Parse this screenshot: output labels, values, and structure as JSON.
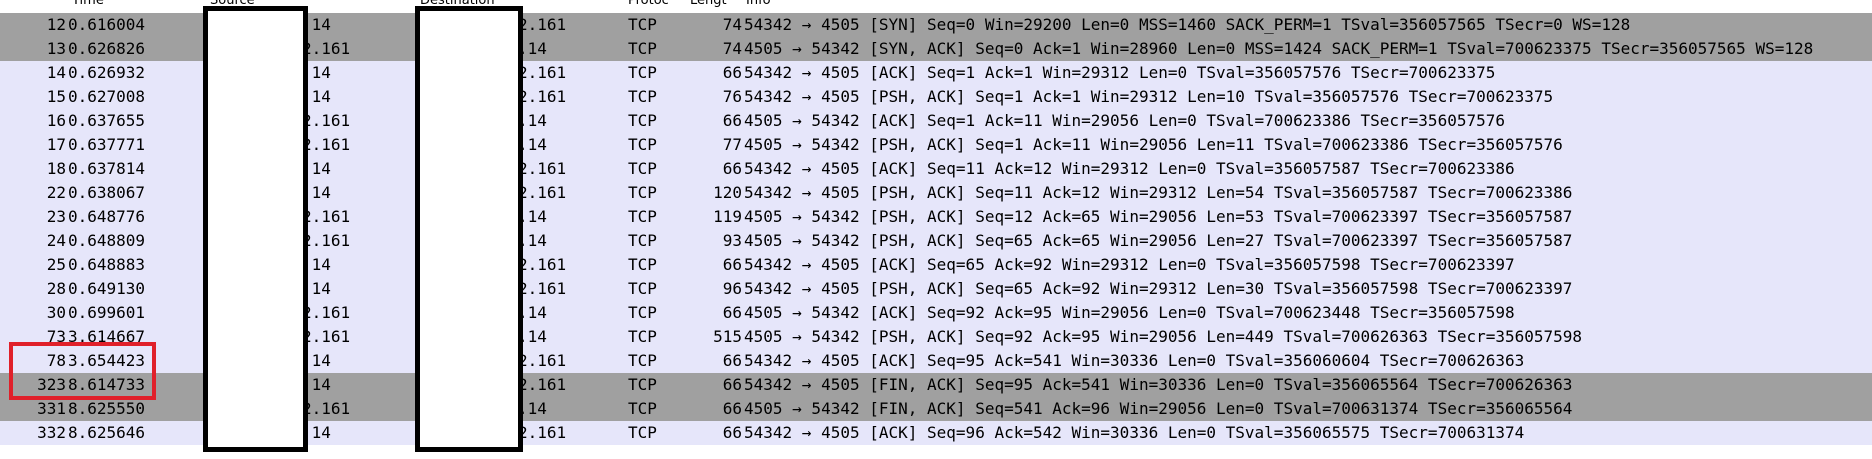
{
  "columns": {
    "time": "Time",
    "source": "Source",
    "destination": "Destination",
    "protocol": "Protoc",
    "length": "Lengt",
    "info": "Info"
  },
  "packets": [
    {
      "no": "12",
      "time": "0.616004",
      "src": ".14",
      "dst": "2.161",
      "proto": "TCP",
      "len": "74",
      "info": "54342 → 4505 [SYN] Seq=0 Win=29200 Len=0 MSS=1460 SACK_PERM=1 TSval=356057565 TSecr=0 WS=128",
      "dark": true
    },
    {
      "no": "13",
      "time": "0.626826",
      "src": "2.161",
      "dst": ".14",
      "proto": "TCP",
      "len": "74",
      "info": "4505 → 54342 [SYN, ACK] Seq=0 Ack=1 Win=28960 Len=0 MSS=1424 SACK_PERM=1 TSval=700623375 TSecr=356057565 WS=128",
      "dark": true
    },
    {
      "no": "14",
      "time": "0.626932",
      "src": ".14",
      "dst": "2.161",
      "proto": "TCP",
      "len": "66",
      "info": "54342 → 4505 [ACK] Seq=1 Ack=1 Win=29312 Len=0 TSval=356057576 TSecr=700623375",
      "dark": false
    },
    {
      "no": "15",
      "time": "0.627008",
      "src": ".14",
      "dst": "2.161",
      "proto": "TCP",
      "len": "76",
      "info": "54342 → 4505 [PSH, ACK] Seq=1 Ack=1 Win=29312 Len=10 TSval=356057576 TSecr=700623375",
      "dark": false
    },
    {
      "no": "16",
      "time": "0.637655",
      "src": "2.161",
      "dst": ".14",
      "proto": "TCP",
      "len": "66",
      "info": "4505 → 54342 [ACK] Seq=1 Ack=11 Win=29056 Len=0 TSval=700623386 TSecr=356057576",
      "dark": false
    },
    {
      "no": "17",
      "time": "0.637771",
      "src": "2.161",
      "dst": ".14",
      "proto": "TCP",
      "len": "77",
      "info": "4505 → 54342 [PSH, ACK] Seq=1 Ack=11 Win=29056 Len=11 TSval=700623386 TSecr=356057576",
      "dark": false
    },
    {
      "no": "18",
      "time": "0.637814",
      "src": ".14",
      "dst": "2.161",
      "proto": "TCP",
      "len": "66",
      "info": "54342 → 4505 [ACK] Seq=11 Ack=12 Win=29312 Len=0 TSval=356057587 TSecr=700623386",
      "dark": false
    },
    {
      "no": "22",
      "time": "0.638067",
      "src": ".14",
      "dst": "2.161",
      "proto": "TCP",
      "len": "120",
      "info": "54342 → 4505 [PSH, ACK] Seq=11 Ack=12 Win=29312 Len=54 TSval=356057587 TSecr=700623386",
      "dark": false
    },
    {
      "no": "23",
      "time": "0.648776",
      "src": "2.161",
      "dst": ".14",
      "proto": "TCP",
      "len": "119",
      "info": "4505 → 54342 [PSH, ACK] Seq=12 Ack=65 Win=29056 Len=53 TSval=700623397 TSecr=356057587",
      "dark": false
    },
    {
      "no": "24",
      "time": "0.648809",
      "src": "2.161",
      "dst": ".14",
      "proto": "TCP",
      "len": "93",
      "info": "4505 → 54342 [PSH, ACK] Seq=65 Ack=65 Win=29056 Len=27 TSval=700623397 TSecr=356057587",
      "dark": false
    },
    {
      "no": "25",
      "time": "0.648883",
      "src": ".14",
      "dst": "2.161",
      "proto": "TCP",
      "len": "66",
      "info": "54342 → 4505 [ACK] Seq=65 Ack=92 Win=29312 Len=0 TSval=356057598 TSecr=700623397",
      "dark": false
    },
    {
      "no": "28",
      "time": "0.649130",
      "src": ".14",
      "dst": "2.161",
      "proto": "TCP",
      "len": "96",
      "info": "54342 → 4505 [PSH, ACK] Seq=65 Ack=92 Win=29312 Len=30 TSval=356057598 TSecr=700623397",
      "dark": false
    },
    {
      "no": "30",
      "time": "0.699601",
      "src": "2.161",
      "dst": ".14",
      "proto": "TCP",
      "len": "66",
      "info": "4505 → 54342 [ACK] Seq=92 Ack=95 Win=29056 Len=0 TSval=700623448 TSecr=356057598",
      "dark": false
    },
    {
      "no": "73",
      "time": "3.614667",
      "src": "2.161",
      "dst": ".14",
      "proto": "TCP",
      "len": "515",
      "info": "4505 → 54342 [PSH, ACK] Seq=92 Ack=95 Win=29056 Len=449 TSval=700626363 TSecr=356057598",
      "dark": false
    },
    {
      "no": "78",
      "time": "3.654423",
      "src": ".14",
      "dst": "2.161",
      "proto": "TCP",
      "len": "66",
      "info": "54342 → 4505 [ACK] Seq=95 Ack=541 Win=30336 Len=0 TSval=356060604 TSecr=700626363",
      "dark": false
    },
    {
      "no": "323",
      "time": "8.614733",
      "src": ".14",
      "dst": "2.161",
      "proto": "TCP",
      "len": "66",
      "info": "54342 → 4505 [FIN, ACK] Seq=95 Ack=541 Win=30336 Len=0 TSval=356065564 TSecr=700626363",
      "dark": true
    },
    {
      "no": "331",
      "time": "8.625550",
      "src": "2.161",
      "dst": ".14",
      "proto": "TCP",
      "len": "66",
      "info": "4505 → 54342 [FIN, ACK] Seq=541 Ack=96 Win=29056 Len=0 TSval=700631374 TSecr=356065564",
      "dark": true
    },
    {
      "no": "332",
      "time": "8.625646",
      "src": ".14",
      "dst": "2.161",
      "proto": "TCP",
      "len": "66",
      "info": "54342 → 4505 [ACK] Seq=96 Ack=542 Win=30336 Len=0 TSval=356065575 TSecr=700631374",
      "dark": false
    }
  ],
  "colors": {
    "row_default": "#e6e6fa",
    "row_dark": "#a0a0a0",
    "highlight_box": "#e0202a",
    "redaction_border": "#000000"
  }
}
